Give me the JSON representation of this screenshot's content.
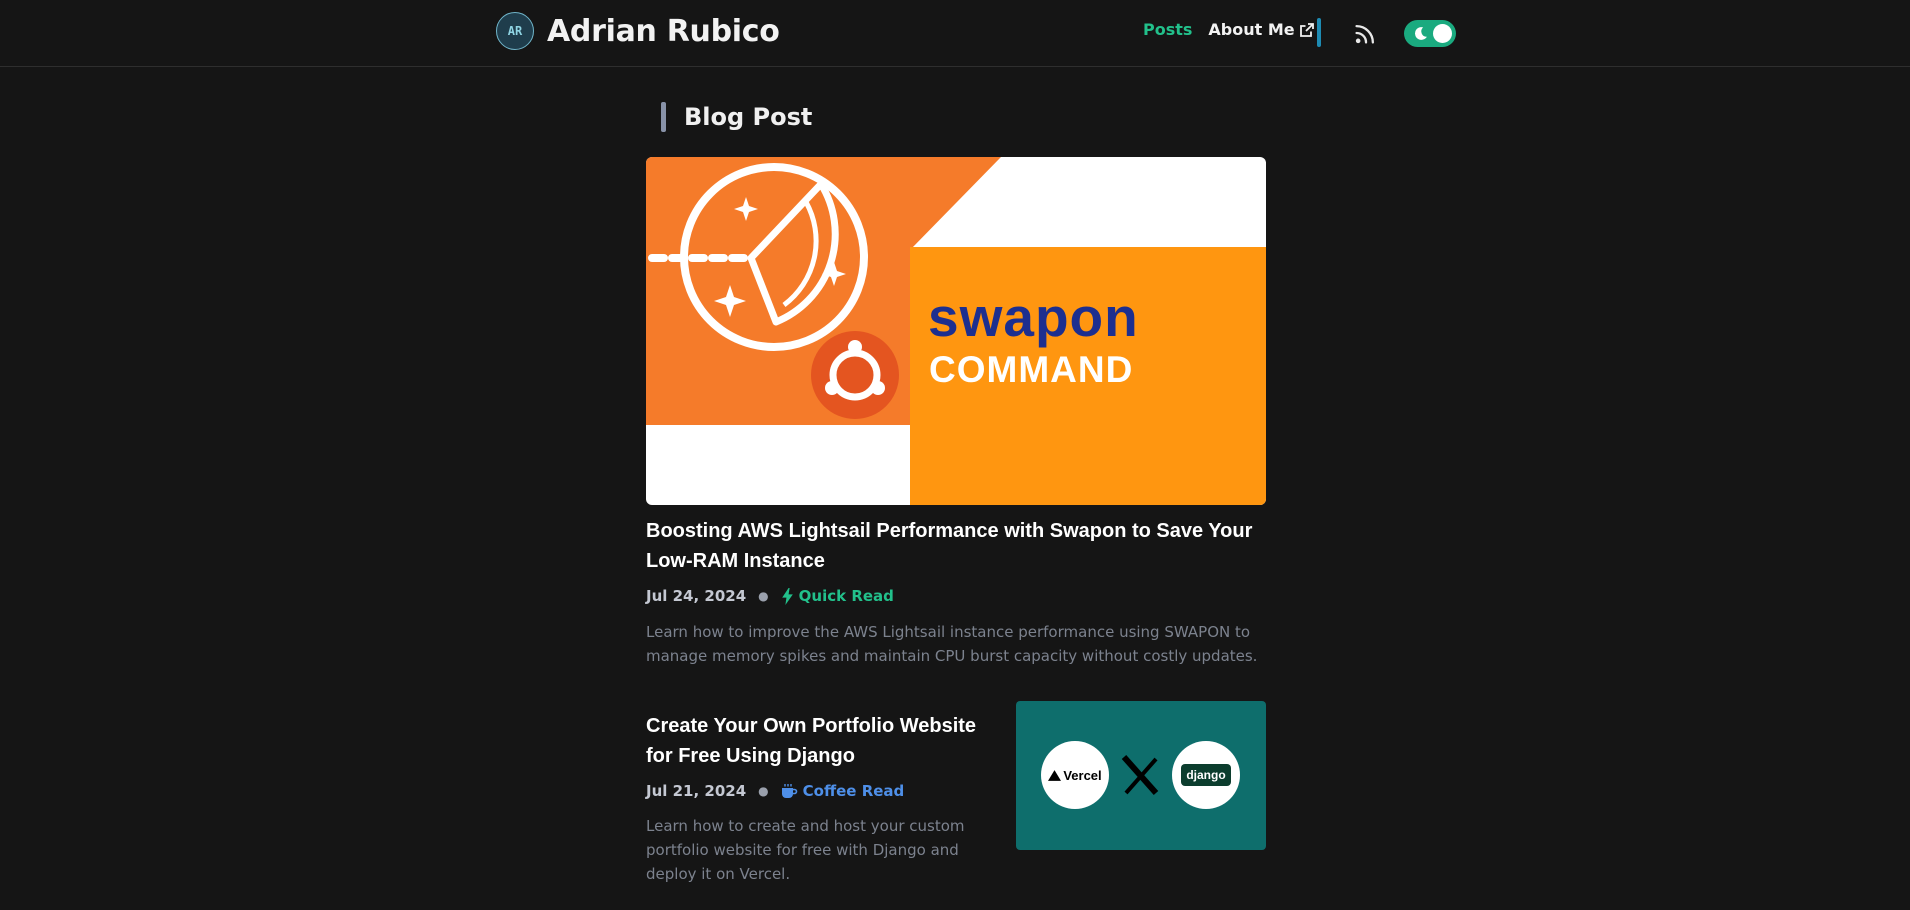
{
  "header": {
    "logo_text": "AR",
    "site_title": "Adrian Rubico",
    "nav": {
      "posts_label": "Posts",
      "about_label": "About Me"
    },
    "icons": {
      "about_external": "external-link-icon",
      "rss": "rss-icon",
      "theme_toggle": "moon-icon"
    },
    "colors": {
      "accent_green": "#22c08b",
      "separator_blue": "#1e8bb3",
      "toggle_bg": "#1aaa7f"
    }
  },
  "main": {
    "section_title": "Blog Post",
    "posts": [
      {
        "image_text_1": "swapon",
        "image_text_2": "COMMAND",
        "title": "Boosting AWS Lightsail Performance with Swapon to Save Your Low-RAM Instance",
        "date": "Jul 24, 2024",
        "read_type": "Quick Read",
        "read_icon": "lightning-icon",
        "excerpt": "Learn how to improve the AWS Lightsail instance performance using SWAPON to manage memory spikes and maintain CPU burst capacity without costly updates."
      },
      {
        "image_text_1": "Vercel",
        "image_text_2": "django",
        "title": "Create Your Own Portfolio Website for Free Using Django",
        "date": "Jul 21, 2024",
        "read_type": "Coffee Read",
        "read_icon": "coffee-icon",
        "excerpt": "Learn how to create and host your custom portfolio website for free with Django and deploy it on Vercel."
      }
    ]
  }
}
